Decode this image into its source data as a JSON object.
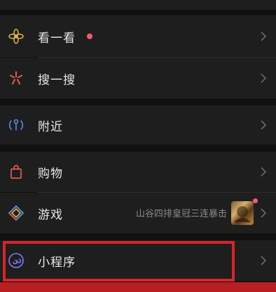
{
  "menu": {
    "items": [
      {
        "label": "看一看",
        "icon": "flower-icon",
        "has_dot": true
      },
      {
        "label": "搜一搜",
        "icon": "star-burst-icon"
      },
      {
        "label": "附近",
        "icon": "location-person-icon"
      },
      {
        "label": "购物",
        "icon": "shopping-bag-icon"
      },
      {
        "label": "游戏",
        "icon": "diamond-icon",
        "subtitle": "山谷四排皇冠三连暴击",
        "has_thumb": true
      },
      {
        "label": "小程序",
        "icon": "mini-program-icon",
        "highlighted": true
      }
    ]
  },
  "colors": {
    "background": "#111111",
    "row": "#1e1e1e",
    "accent_red": "#d4262a",
    "dot_red": "#f25d68"
  }
}
